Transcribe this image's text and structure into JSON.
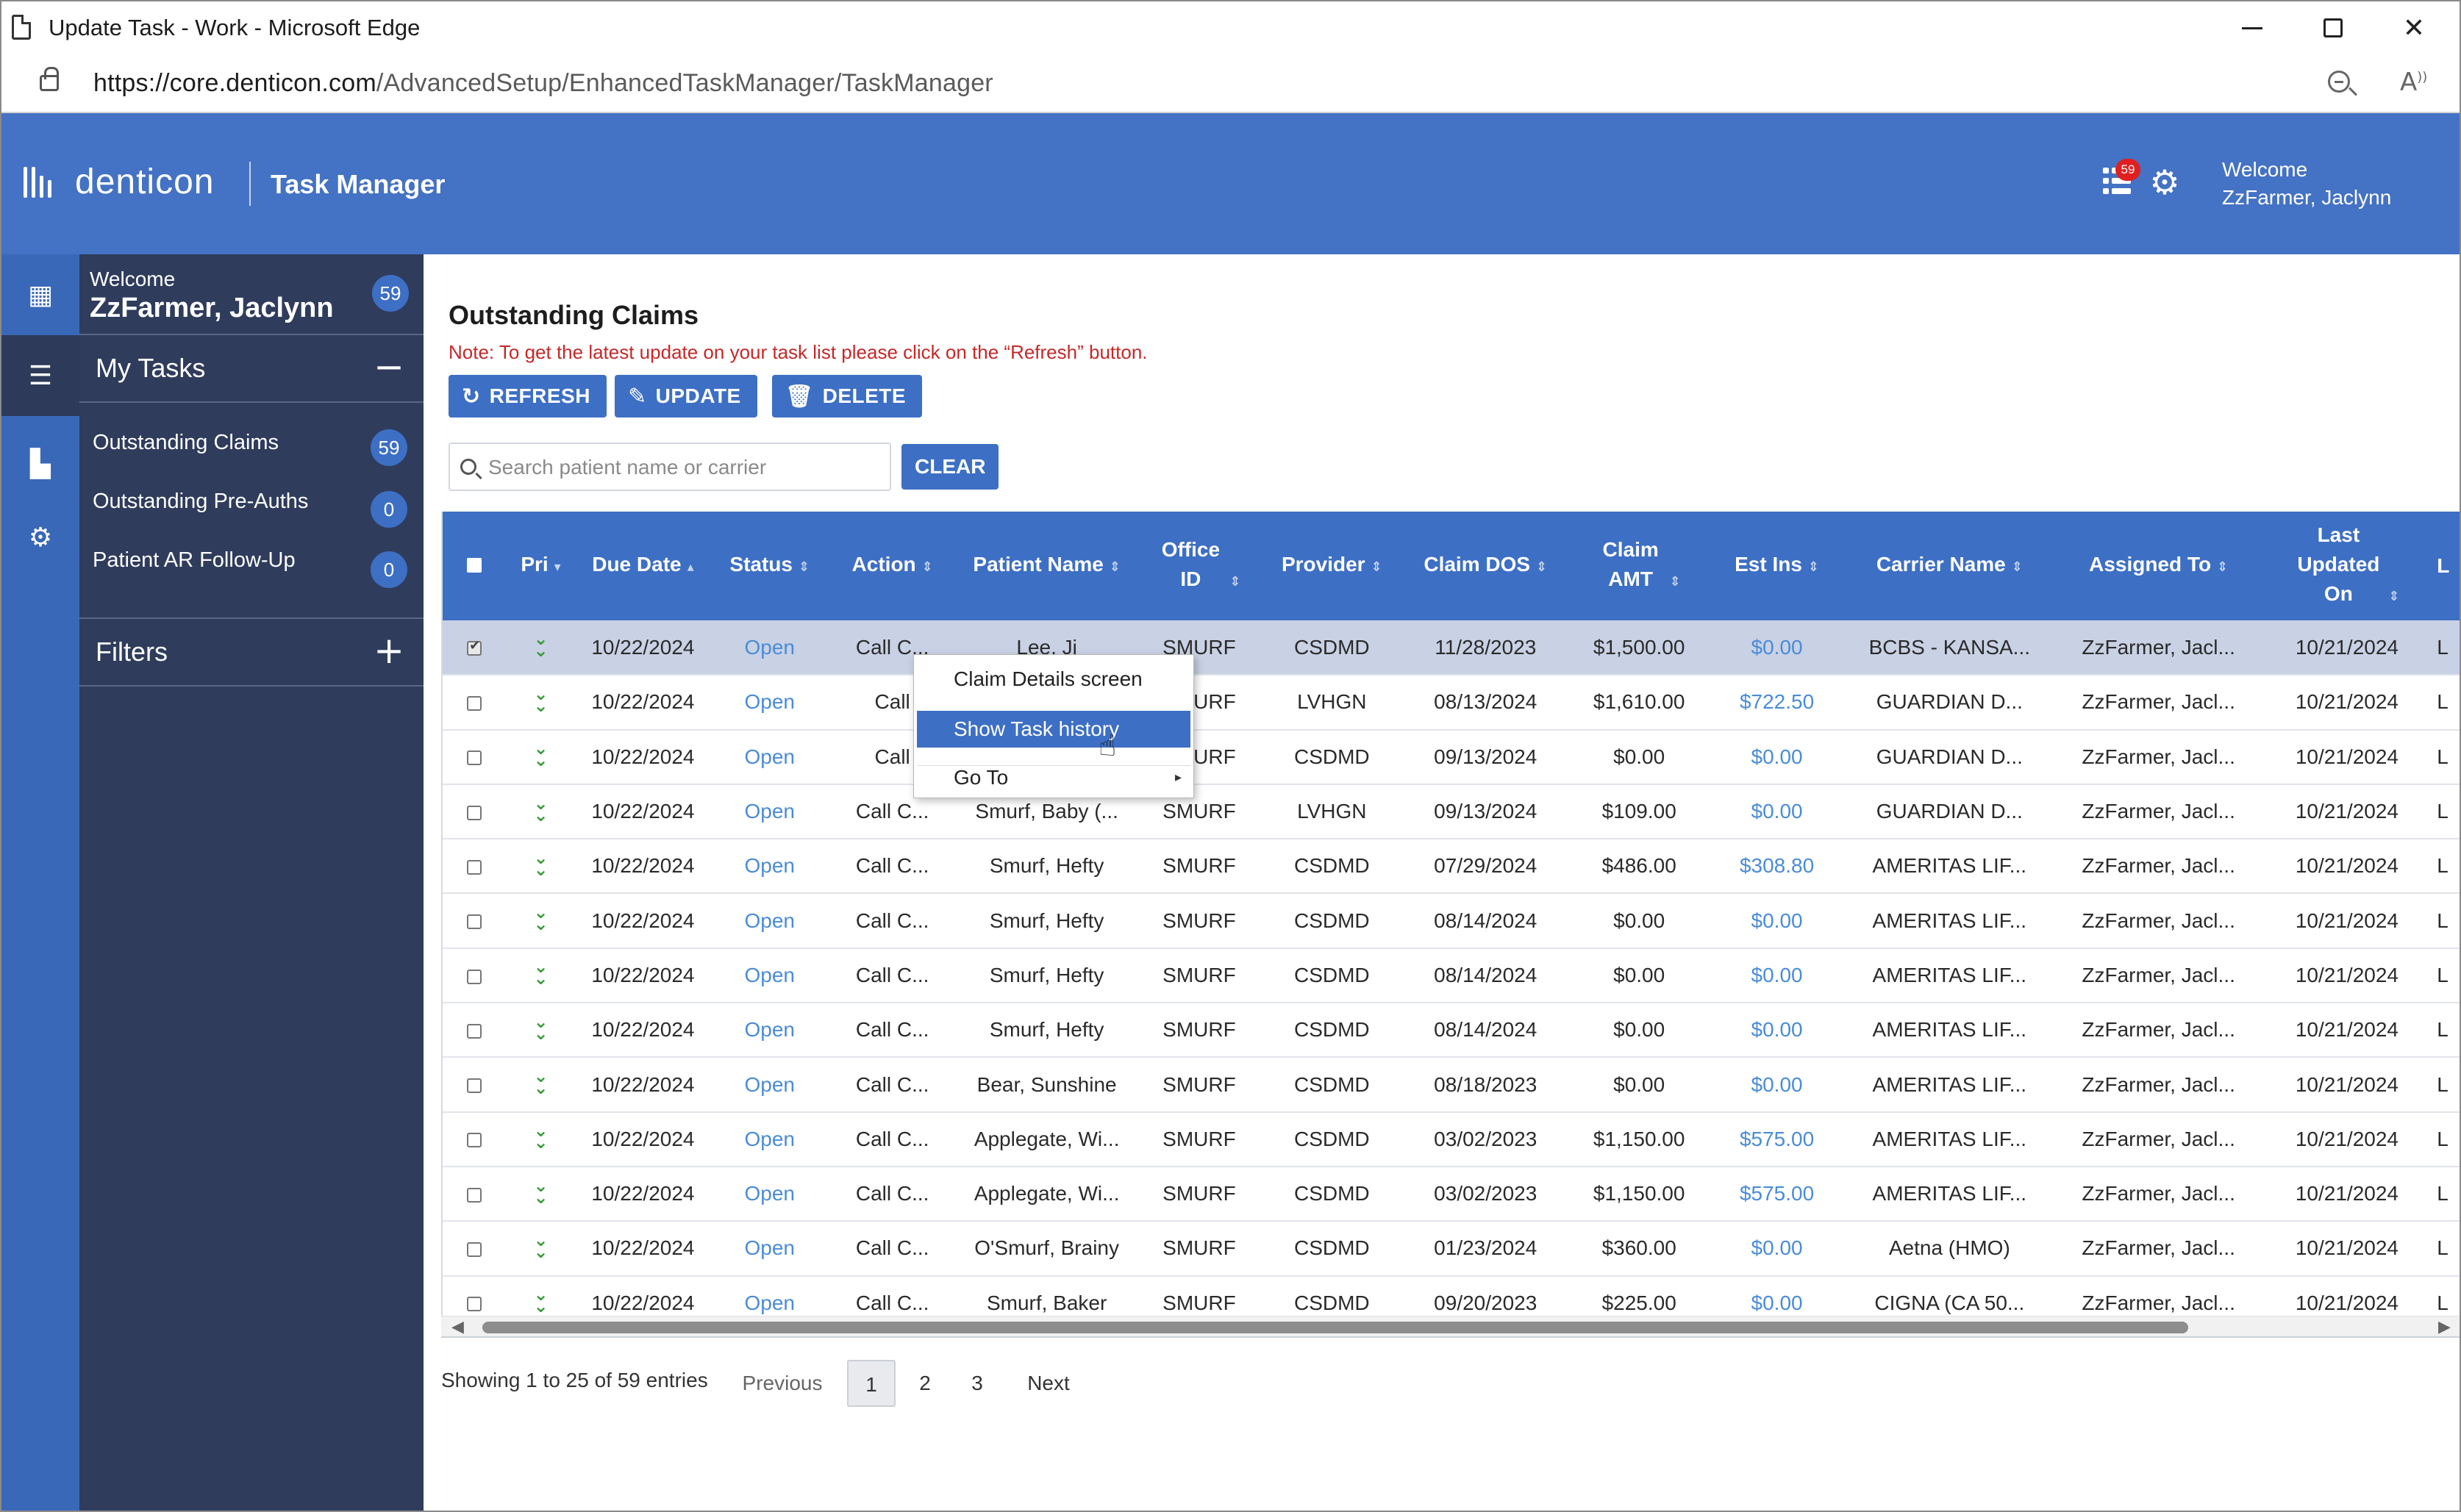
{
  "browser": {
    "window_title": "Update Task - Work - Microsoft Edge",
    "url_host": "https://core.denticon.com",
    "url_path": "/AdvancedSetup/EnhancedTaskManager/TaskManager"
  },
  "header": {
    "logo": "denticon",
    "app_title": "Task Manager",
    "notification_count": "59",
    "welcome_line1": "Welcome",
    "welcome_line2": "ZzFarmer, Jaclynn"
  },
  "sidebar": {
    "welcome": "Welcome",
    "user_name": "ZzFarmer, Jaclynn",
    "total_badge": "59",
    "my_tasks_label": "My Tasks",
    "my_tasks_toggle": "−",
    "items": [
      {
        "label": "Outstanding Claims",
        "count": "59"
      },
      {
        "label": "Outstanding Pre-Auths",
        "count": "0"
      },
      {
        "label": "Patient AR Follow-Up",
        "count": "0"
      }
    ],
    "filters_label": "Filters",
    "filters_toggle": "+"
  },
  "main": {
    "title": "Outstanding Claims",
    "note": "Note: To get the latest update on your task list please click on the “Refresh” button.",
    "buttons": {
      "refresh": "REFRESH",
      "update": "UPDATE",
      "delete": "DELETE",
      "clear": "CLEAR"
    },
    "search_placeholder": "Search patient name or carrier"
  },
  "table": {
    "headers": [
      "Pri",
      "Due Date",
      "Status",
      "Action",
      "Patient Name",
      "Office ID",
      "Provider",
      "Claim DOS",
      "Claim AMT",
      "Est Ins",
      "Carrier Name",
      "Assigned To",
      "Last Updated On",
      "L"
    ],
    "rows": [
      {
        "due": "10/22/2024",
        "status": "Open",
        "action": "Call C...",
        "patient": "Lee, Jj",
        "office": "SMURF",
        "provider": "CSDMD",
        "dos": "11/28/2023",
        "amt": "$1,500.00",
        "est": "$0.00",
        "carrier": "BCBS - KANSA...",
        "assigned": "ZzFarmer, Jacl...",
        "updated": "10/21/2024",
        "l": "L"
      },
      {
        "due": "10/22/2024",
        "status": "Open",
        "action": "Call",
        "patient": "",
        "office": "SMURF",
        "provider": "LVHGN",
        "dos": "08/13/2024",
        "amt": "$1,610.00",
        "est": "$722.50",
        "carrier": "GUARDIAN D...",
        "assigned": "ZzFarmer, Jacl...",
        "updated": "10/21/2024",
        "l": "L"
      },
      {
        "due": "10/22/2024",
        "status": "Open",
        "action": "Call",
        "patient": "",
        "office": "SMURF",
        "provider": "CSDMD",
        "dos": "09/13/2024",
        "amt": "$0.00",
        "est": "$0.00",
        "carrier": "GUARDIAN D...",
        "assigned": "ZzFarmer, Jacl...",
        "updated": "10/21/2024",
        "l": "L"
      },
      {
        "due": "10/22/2024",
        "status": "Open",
        "action": "Call C...",
        "patient": "Smurf, Baby (...",
        "office": "SMURF",
        "provider": "LVHGN",
        "dos": "09/13/2024",
        "amt": "$109.00",
        "est": "$0.00",
        "carrier": "GUARDIAN D...",
        "assigned": "ZzFarmer, Jacl...",
        "updated": "10/21/2024",
        "l": "L"
      },
      {
        "due": "10/22/2024",
        "status": "Open",
        "action": "Call C...",
        "patient": "Smurf, Hefty",
        "office": "SMURF",
        "provider": "CSDMD",
        "dos": "07/29/2024",
        "amt": "$486.00",
        "est": "$308.80",
        "carrier": "AMERITAS LIF...",
        "assigned": "ZzFarmer, Jacl...",
        "updated": "10/21/2024",
        "l": "L"
      },
      {
        "due": "10/22/2024",
        "status": "Open",
        "action": "Call C...",
        "patient": "Smurf, Hefty",
        "office": "SMURF",
        "provider": "CSDMD",
        "dos": "08/14/2024",
        "amt": "$0.00",
        "est": "$0.00",
        "carrier": "AMERITAS LIF...",
        "assigned": "ZzFarmer, Jacl...",
        "updated": "10/21/2024",
        "l": "L"
      },
      {
        "due": "10/22/2024",
        "status": "Open",
        "action": "Call C...",
        "patient": "Smurf, Hefty",
        "office": "SMURF",
        "provider": "CSDMD",
        "dos": "08/14/2024",
        "amt": "$0.00",
        "est": "$0.00",
        "carrier": "AMERITAS LIF...",
        "assigned": "ZzFarmer, Jacl...",
        "updated": "10/21/2024",
        "l": "L"
      },
      {
        "due": "10/22/2024",
        "status": "Open",
        "action": "Call C...",
        "patient": "Smurf, Hefty",
        "office": "SMURF",
        "provider": "CSDMD",
        "dos": "08/14/2024",
        "amt": "$0.00",
        "est": "$0.00",
        "carrier": "AMERITAS LIF...",
        "assigned": "ZzFarmer, Jacl...",
        "updated": "10/21/2024",
        "l": "L"
      },
      {
        "due": "10/22/2024",
        "status": "Open",
        "action": "Call C...",
        "patient": "Bear, Sunshine",
        "office": "SMURF",
        "provider": "CSDMD",
        "dos": "08/18/2023",
        "amt": "$0.00",
        "est": "$0.00",
        "carrier": "AMERITAS LIF...",
        "assigned": "ZzFarmer, Jacl...",
        "updated": "10/21/2024",
        "l": "L"
      },
      {
        "due": "10/22/2024",
        "status": "Open",
        "action": "Call C...",
        "patient": "Applegate, Wi...",
        "office": "SMURF",
        "provider": "CSDMD",
        "dos": "03/02/2023",
        "amt": "$1,150.00",
        "est": "$575.00",
        "carrier": "AMERITAS LIF...",
        "assigned": "ZzFarmer, Jacl...",
        "updated": "10/21/2024",
        "l": "L"
      },
      {
        "due": "10/22/2024",
        "status": "Open",
        "action": "Call C...",
        "patient": "Applegate, Wi...",
        "office": "SMURF",
        "provider": "CSDMD",
        "dos": "03/02/2023",
        "amt": "$1,150.00",
        "est": "$575.00",
        "carrier": "AMERITAS LIF...",
        "assigned": "ZzFarmer, Jacl...",
        "updated": "10/21/2024",
        "l": "L"
      },
      {
        "due": "10/22/2024",
        "status": "Open",
        "action": "Call C...",
        "patient": "O'Smurf, Brainy",
        "office": "SMURF",
        "provider": "CSDMD",
        "dos": "01/23/2024",
        "amt": "$360.00",
        "est": "$0.00",
        "carrier": "Aetna (HMO)",
        "assigned": "ZzFarmer, Jacl...",
        "updated": "10/21/2024",
        "l": "L"
      },
      {
        "due": "10/22/2024",
        "status": "Open",
        "action": "Call C...",
        "patient": "Smurf, Baker",
        "office": "SMURF",
        "provider": "CSDMD",
        "dos": "09/20/2023",
        "amt": "$225.00",
        "est": "$0.00",
        "carrier": "CIGNA (CA 50...",
        "assigned": "ZzFarmer, Jacl...",
        "updated": "10/21/2024",
        "l": "L"
      }
    ]
  },
  "pagination": {
    "info": "Showing 1 to 25 of 59 entries",
    "previous": "Previous",
    "pages": [
      "1",
      "2",
      "3"
    ],
    "next": "Next"
  },
  "context_menu": {
    "items": [
      "Claim Details screen",
      "Show Task history",
      "Go To"
    ]
  },
  "colors": {
    "brand": "#4472c4",
    "sidebar": "#2f3c5c",
    "button": "#3d6fc4",
    "note": "#c62828",
    "link": "#4a8cd8"
  }
}
